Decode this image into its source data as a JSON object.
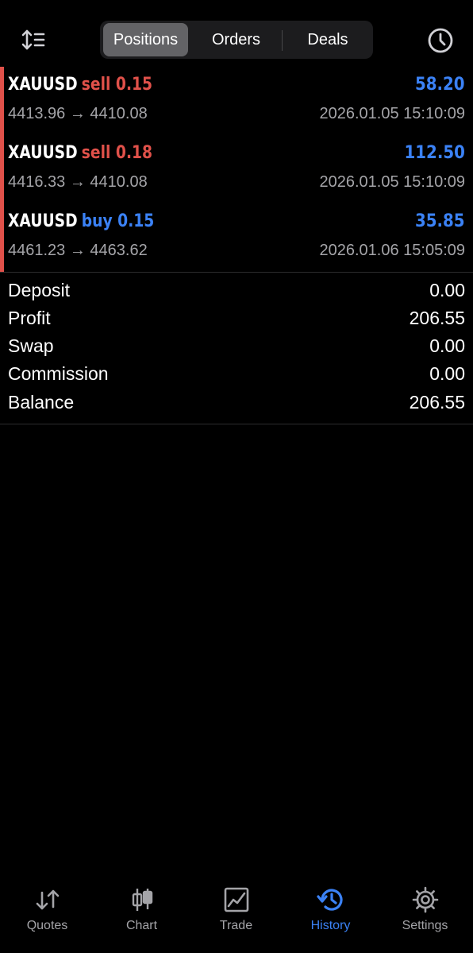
{
  "colors": {
    "background": "#000000",
    "sell": "#e0514a",
    "buy": "#3b82f6",
    "profit_positive": "#3b82f6",
    "accent_bar": "#e0514a",
    "secondary_text": "#a4a4a8",
    "active_tab": "#3b82f6"
  },
  "header": {
    "sort_icon": "sort-arrows-icon",
    "clock_icon": "clock-icon",
    "segments": [
      {
        "label": "Positions",
        "active": true
      },
      {
        "label": "Orders",
        "active": false
      },
      {
        "label": "Deals",
        "active": false
      }
    ]
  },
  "deals": [
    {
      "symbol": "XAUUSD",
      "type": "sell 0.15",
      "side": "sell",
      "profit": "58.20",
      "prices": "4413.96 → 4410.08",
      "time": "2026.01.05 15:10:09"
    },
    {
      "symbol": "XAUUSD",
      "type": "sell 0.18",
      "side": "sell",
      "profit": "112.50",
      "prices": "4416.33 → 4410.08",
      "time": "2026.01.05 15:10:09"
    },
    {
      "symbol": "XAUUSD",
      "type": "buy 0.15",
      "side": "buy",
      "profit": "35.85",
      "prices": "4461.23 → 4463.62",
      "time": "2026.01.06 15:05:09"
    }
  ],
  "summary": [
    {
      "label": "Deposit",
      "value": "0.00"
    },
    {
      "label": "Profit",
      "value": "206.55"
    },
    {
      "label": "Swap",
      "value": "0.00"
    },
    {
      "label": "Commission",
      "value": "0.00"
    },
    {
      "label": "Balance",
      "value": "206.55"
    }
  ],
  "tabbar": {
    "tabs": [
      {
        "label": "Quotes",
        "icon": "quotes-arrows-icon",
        "active": false
      },
      {
        "label": "Chart",
        "icon": "candlestick-chart-icon",
        "active": false
      },
      {
        "label": "Trade",
        "icon": "trade-chart-icon",
        "active": false
      },
      {
        "label": "History",
        "icon": "history-clock-icon",
        "active": true
      },
      {
        "label": "Settings",
        "icon": "gear-icon",
        "active": false
      }
    ]
  }
}
